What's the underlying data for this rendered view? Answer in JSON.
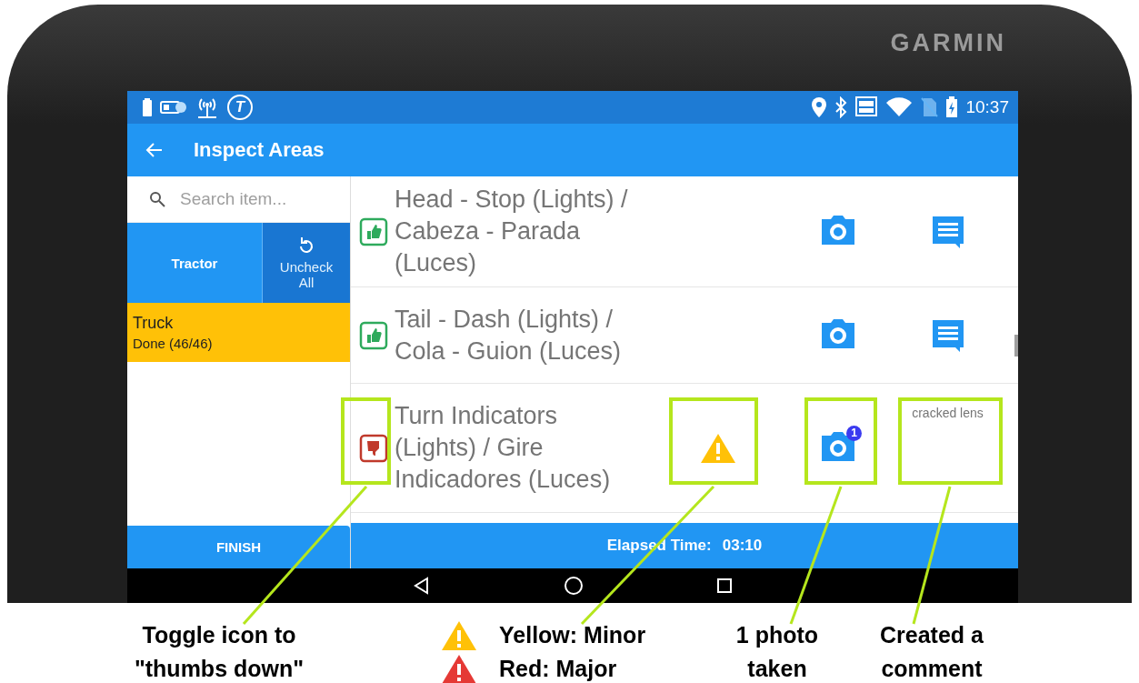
{
  "device": {
    "brand": "GARMIN"
  },
  "status_bar": {
    "app_badge": "T",
    "time": "10:37"
  },
  "app_bar": {
    "title": "Inspect Areas"
  },
  "sidebar": {
    "search": {
      "placeholder": "Search item..."
    },
    "categories": [
      {
        "label": "Tractor",
        "selected": true
      }
    ],
    "uncheck_all": "Uncheck All",
    "groups": [
      {
        "name": "Truck",
        "status": "Done (46/46)",
        "complete": true
      }
    ],
    "finish": "FINISH"
  },
  "items": [
    {
      "name": "Head - Stop (Lights) / Cabeza - Parada (Luces)",
      "passed": true
    },
    {
      "name": "Tail - Dash (Lights) / Cola - Guion (Luces)",
      "passed": true
    },
    {
      "name": "Turn Indicators (Lights) / Gire Indicadores (Luces)",
      "passed": false,
      "major": false,
      "photo_count": "1",
      "comment": "cracked lens"
    }
  ],
  "footer": {
    "elapsed_label": "Elapsed Time:",
    "elapsed": "03:10"
  },
  "annotations": [
    {
      "kind": "caption",
      "lines": [
        "Toggle icon to",
        "\"thumbs down\""
      ]
    },
    {
      "kind": "legend",
      "entries": [
        {
          "major": false,
          "text": "Yellow: Minor"
        },
        {
          "major": true,
          "text": "Red: Major"
        }
      ]
    },
    {
      "kind": "caption",
      "lines": [
        "1 photo",
        "taken"
      ]
    },
    {
      "kind": "caption",
      "lines": [
        "Created a",
        "comment"
      ]
    }
  ]
}
